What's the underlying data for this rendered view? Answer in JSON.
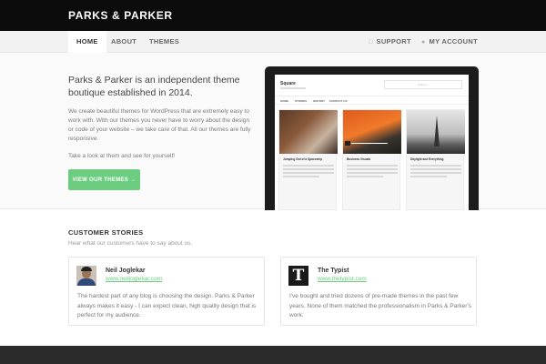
{
  "header": {
    "brand": "PARKS & PARKER"
  },
  "nav": {
    "left": [
      {
        "label": "HOME",
        "active": true
      },
      {
        "label": "ABOUT",
        "active": false
      },
      {
        "label": "THEMES",
        "active": false
      }
    ],
    "right": [
      {
        "label": "SUPPORT",
        "icon": "support-icon"
      },
      {
        "label": "MY ACCOUNT",
        "icon": "user-icon"
      }
    ]
  },
  "hero": {
    "heading": "Parks & Parker is an independent theme boutique established in 2014.",
    "body": "We create beautiful themes for WordPress that are extremely easy to work with. With our themes you never have to worry about the design or code of your website – we take care of that. All our themes are fully responsive.",
    "cta_text": "Take a look at them and see for yourself!",
    "cta_button": "VIEW OUR THEMES →",
    "preview": {
      "title": "Square",
      "search_placeholder": "Search...",
      "nav": [
        "HOME",
        "STORIES",
        "HISTORY",
        "CONTACT US"
      ],
      "cards": [
        "Jumping Out of a Spaceship",
        "Business Visuals",
        "Daylight and Everything"
      ]
    }
  },
  "stories": {
    "heading": "CUSTOMER STORIES",
    "subheading": "Hear what our customers have to say about us.",
    "items": [
      {
        "name": "Neil Joglekar",
        "link": "www.neiljoglekar.com",
        "quote": "The hardest part of any blog is choosing the design. Parks & Parker always makes it easy - I can expect clean, high quality design that is perfect for my audience."
      },
      {
        "name": "The Typist",
        "link": "www.thetypist.com",
        "quote": "I've bought and tried dozens of pre-made themes in the past few years. None of them matched the professionalism in Parks & Parker's work."
      }
    ]
  },
  "colors": {
    "accent": "#6ccd80",
    "header_bg": "#0c0c0c",
    "footer_bg": "#2b2b2b"
  }
}
